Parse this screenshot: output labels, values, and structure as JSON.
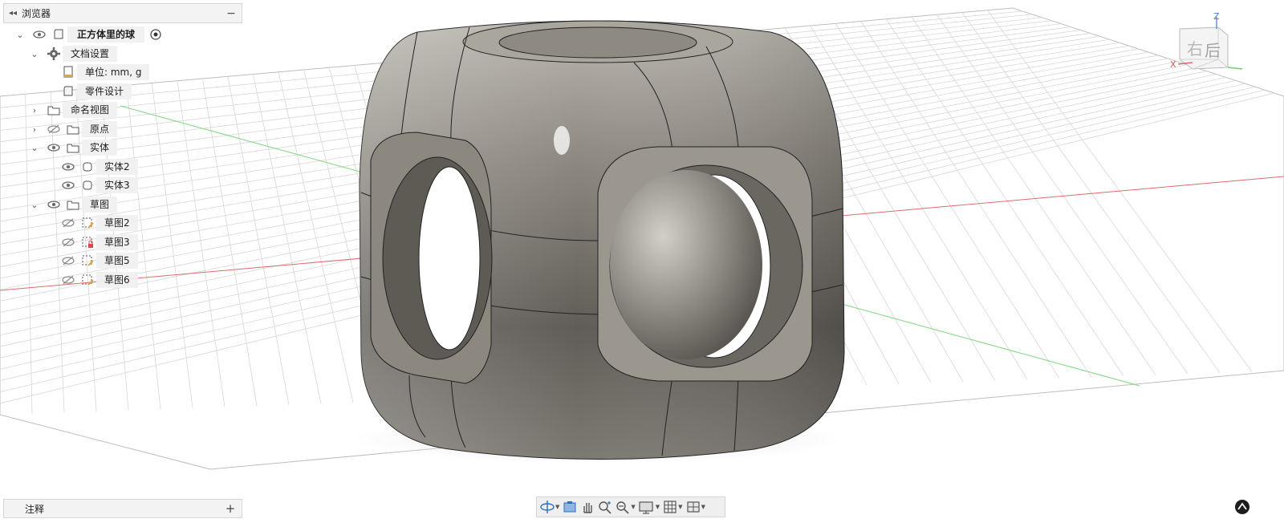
{
  "browser": {
    "title": "浏览器",
    "collapse_icon": "double-chevron-left-icon",
    "minimize_label": "−",
    "root": {
      "label": "正方体里的球"
    },
    "doc_settings": {
      "label": "文档设置"
    },
    "units": {
      "label": "单位: mm, g"
    },
    "part_design": {
      "label": "零件设计"
    },
    "named_views": {
      "label": "命名视图"
    },
    "origin": {
      "label": "原点"
    },
    "bodies": {
      "label": "实体",
      "items": [
        {
          "label": "实体2"
        },
        {
          "label": "实体3"
        }
      ]
    },
    "sketches": {
      "label": "草图",
      "items": [
        {
          "label": "草图2"
        },
        {
          "label": "草图3"
        },
        {
          "label": "草图5"
        },
        {
          "label": "草图6"
        }
      ]
    }
  },
  "notes": {
    "label": "注释",
    "add_label": "+"
  },
  "viewcube": {
    "face_left": "右",
    "face_front": "后",
    "axis_z": "Z",
    "axis_x": "X"
  },
  "toolbar": {
    "items": [
      "orbit-icon",
      "look-at-icon",
      "pan-icon",
      "zoom-icon",
      "fit-icon",
      "display-settings-icon",
      "grid-icon",
      "viewports-icon"
    ]
  },
  "colors": {
    "axis_red": "#e06a6a",
    "axis_green": "#7fd67f",
    "grid": "#d7d7d7",
    "body": "#7d7a73"
  }
}
